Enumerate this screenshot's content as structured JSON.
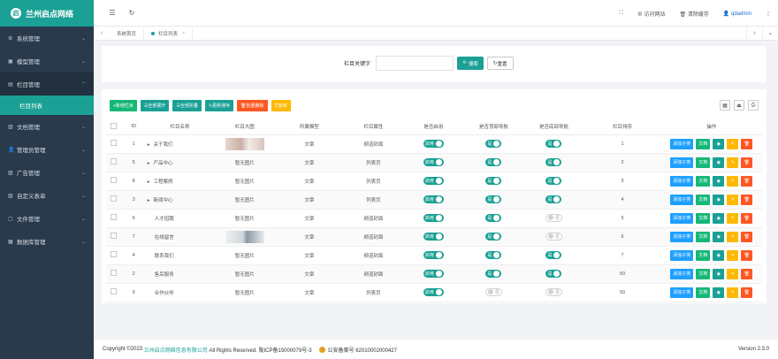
{
  "brand": {
    "title": "兰州启点网络"
  },
  "sidebar": {
    "items": [
      {
        "label": "系统管理",
        "icon": "gear-icon"
      },
      {
        "label": "模型管理",
        "icon": "model-icon"
      },
      {
        "label": "栏目管理",
        "icon": "column-icon"
      },
      {
        "label": "文档管理",
        "icon": "document-icon"
      },
      {
        "label": "管理员管理",
        "icon": "user-icon"
      },
      {
        "label": "广告管理",
        "icon": "ad-icon"
      },
      {
        "label": "自定义表单",
        "icon": "form-icon"
      },
      {
        "label": "文件管理",
        "icon": "file-icon"
      },
      {
        "label": "数据库管理",
        "icon": "database-icon"
      }
    ],
    "sub_active": "栏目列表"
  },
  "topbar": {
    "visit_site": "访问网站",
    "clear_cache": "清除缓存",
    "user": "qdadmin"
  },
  "tabs": {
    "home": "系统首页",
    "current": "栏目列表"
  },
  "search": {
    "label": "栏目关键字",
    "search_btn": "搜索",
    "reset_btn": "重置",
    "value": ""
  },
  "toolbar": {
    "add": "新增栏目",
    "expand": "全部展开",
    "collapse": "全部折叠",
    "sort": "更新排序",
    "batch_delete": "批量删除",
    "copy": "复制"
  },
  "table": {
    "headers": [
      "ID",
      "栏目名称",
      "栏目大图",
      "所属模型",
      "栏目属性",
      "是否启用",
      "是否顶部导航",
      "是否底部导航",
      "栏目排序",
      "操作"
    ],
    "rows": [
      {
        "id": "1",
        "name": "关于我们",
        "expand": true,
        "img": "image",
        "model": "文章",
        "attr": "频道封面",
        "enabled": true,
        "top": true,
        "bottom": true,
        "sort": "1"
      },
      {
        "id": "5",
        "name": "产品中心",
        "expand": true,
        "img": "暂无图片",
        "model": "文章",
        "attr": "列表页",
        "enabled": true,
        "top": true,
        "bottom": true,
        "sort": "2"
      },
      {
        "id": "8",
        "name": "工程案例",
        "expand": true,
        "img": "暂无图片",
        "model": "文章",
        "attr": "列表页",
        "enabled": true,
        "top": true,
        "bottom": true,
        "sort": "3"
      },
      {
        "id": "3",
        "name": "新闻中心",
        "expand": true,
        "img": "暂无图片",
        "model": "文章",
        "attr": "列表页",
        "enabled": true,
        "top": true,
        "bottom": true,
        "sort": "4"
      },
      {
        "id": "6",
        "name": "人才招聘",
        "expand": false,
        "img": "暂无图片",
        "model": "文章",
        "attr": "频道封面",
        "enabled": true,
        "top": true,
        "bottom": false,
        "sort": "5"
      },
      {
        "id": "7",
        "name": "在线留言",
        "expand": false,
        "img": "image2",
        "model": "文章",
        "attr": "频道封面",
        "enabled": true,
        "top": true,
        "bottom": false,
        "sort": "6"
      },
      {
        "id": "4",
        "name": "联系我们",
        "expand": false,
        "img": "暂无图片",
        "model": "文章",
        "attr": "频道封面",
        "enabled": true,
        "top": true,
        "bottom": true,
        "sort": "7"
      },
      {
        "id": "2",
        "name": "售后服务",
        "expand": false,
        "img": "暂无图片",
        "model": "文章",
        "attr": "频道封面",
        "enabled": true,
        "top": true,
        "bottom": true,
        "sort": "50"
      },
      {
        "id": "9",
        "name": "合作伙伴",
        "expand": false,
        "img": "暂无图片",
        "model": "文章",
        "attr": "列表页",
        "enabled": true,
        "top": false,
        "bottom": false,
        "sort": "50"
      }
    ],
    "switch_on": "启用",
    "switch_off": "否",
    "switch_yes": "是",
    "ops": {
      "add_child": "添加子类",
      "doc": "文档"
    }
  },
  "footer": {
    "copyright": "Copyright ©2023",
    "company": "兰州启点网络信息有限公司",
    "rights": "All Rights Reserved. 陇ICP备15000079号-3",
    "police": "公安备案号 62010002000427",
    "version": "Version 2.3.0"
  },
  "colors": {
    "accent": "#1aa094",
    "sidebar": "#2a3a4d",
    "blue": "#1e9fff",
    "orange": "#ffb800",
    "red": "#ff5722"
  }
}
